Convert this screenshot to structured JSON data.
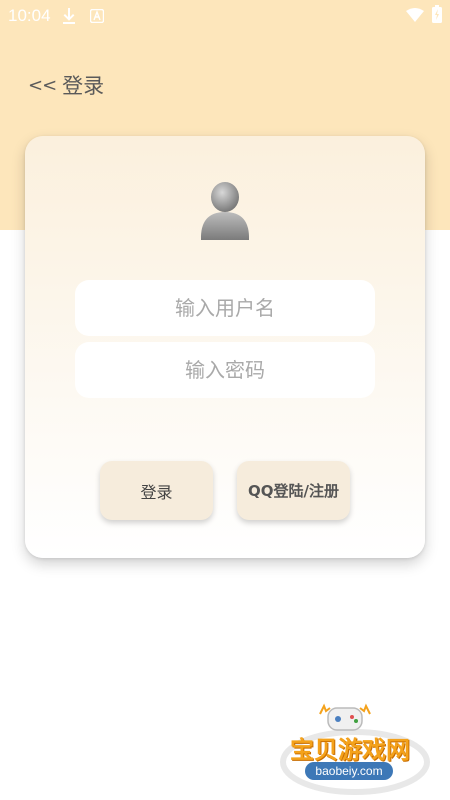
{
  "status_bar": {
    "time": "10:04",
    "icons": [
      "download-icon",
      "a-notification-icon",
      "wifi-icon",
      "battery-icon"
    ]
  },
  "header": {
    "back_icon": "<<",
    "title": "登录"
  },
  "form": {
    "username_placeholder": "输入用户名",
    "password_placeholder": "输入密码",
    "login_label": "登录",
    "qq_label": "QQ登陆/注册"
  },
  "watermark": {
    "name": "宝贝游戏网",
    "url": "baobeiy.com"
  },
  "colors": {
    "top_band": "#fde6bb",
    "card_top": "#fbf0dd",
    "button": "#f6ecdc",
    "watermark_text": "#f4a21b"
  }
}
